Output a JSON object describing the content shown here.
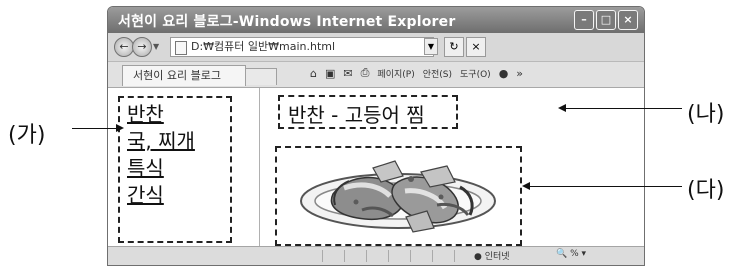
{
  "window": {
    "title": "서현이 요리 블로그-Windows Internet Explorer",
    "controls": [
      "minimize-icon",
      "maximize-icon",
      "close-icon"
    ]
  },
  "address": {
    "text": "D:₩컴퓨터 일반₩main.html"
  },
  "tab": {
    "label": "서현이 요리 블로그"
  },
  "toolbar": {
    "items": [
      "페이지(P)",
      "안전(S)",
      "도구(O)"
    ]
  },
  "page": {
    "nav_links": [
      "반찬",
      "국, 찌개",
      "특식",
      "간식"
    ],
    "main_title": "반찬 - 고등어 찜"
  },
  "status": {
    "zone": "인터넷",
    "zoom": "%"
  },
  "labels": {
    "ga": "(가)",
    "na": "(나)",
    "da": "(다)"
  }
}
